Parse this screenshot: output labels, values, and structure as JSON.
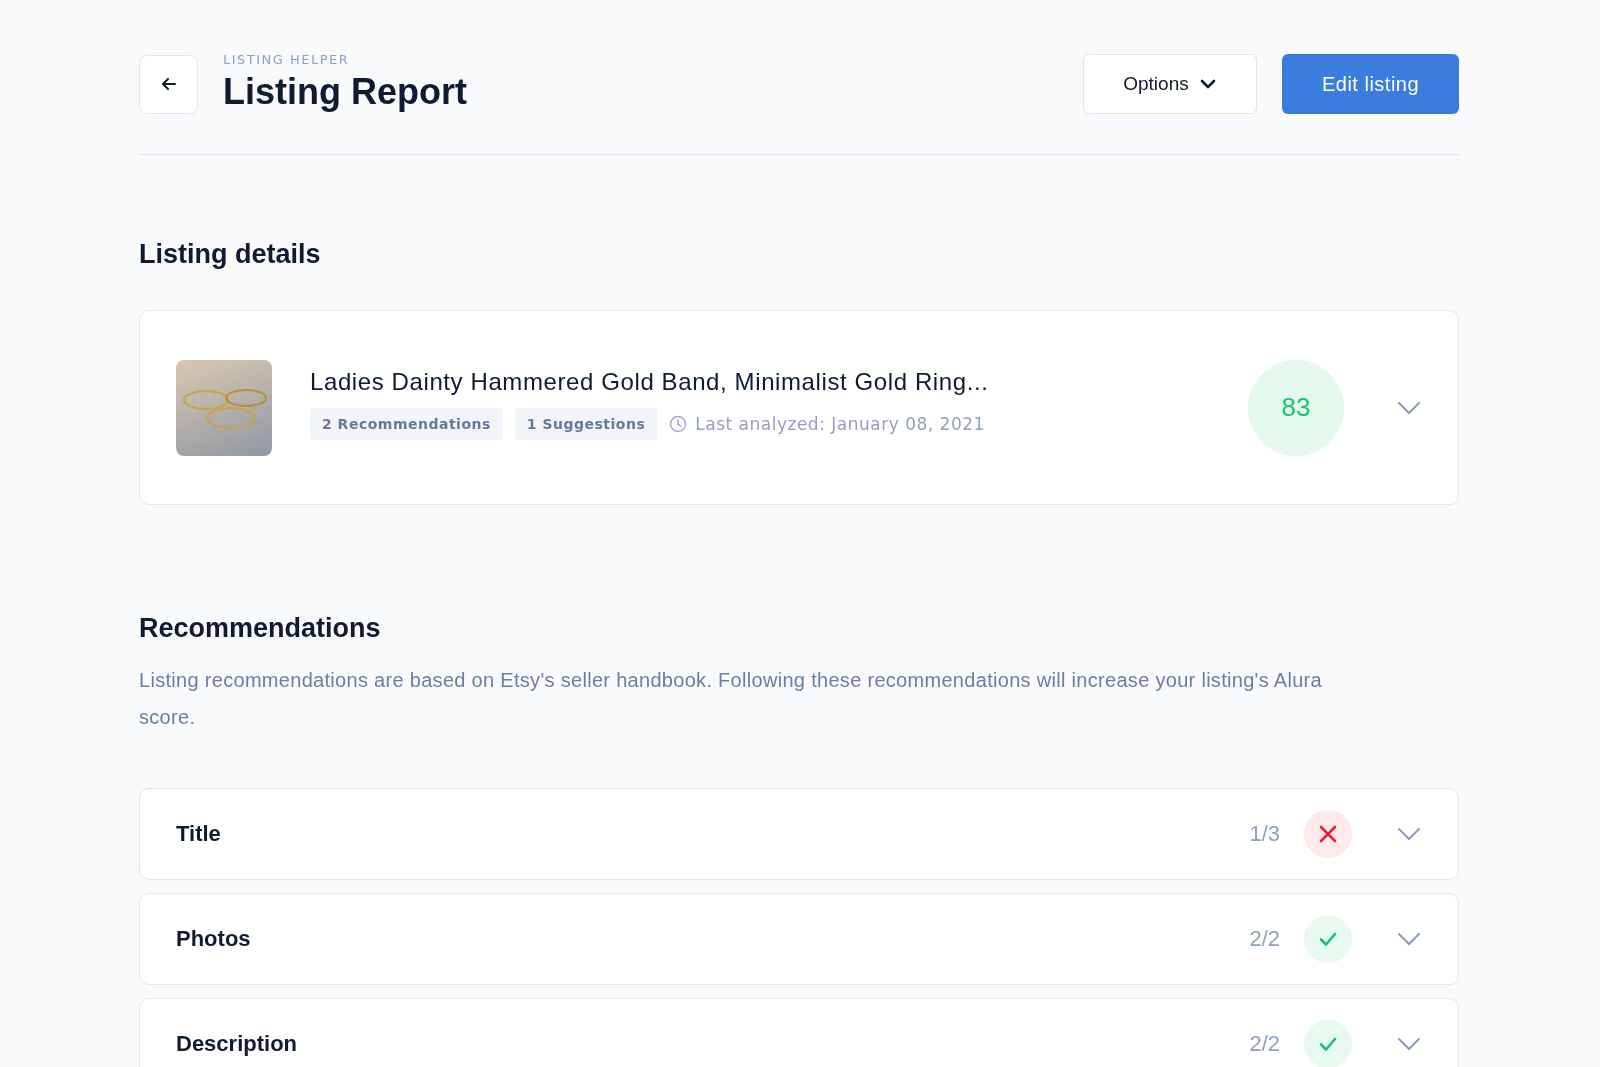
{
  "header": {
    "eyebrow": "LISTING HELPER",
    "title": "Listing Report",
    "options_button": "Options",
    "edit_button": "Edit listing"
  },
  "listing_details": {
    "heading": "Listing details",
    "title": "Ladies Dainty Hammered Gold Band, Minimalist Gold Ring...",
    "tags": [
      "2 Recommendations",
      "1 Suggestions"
    ],
    "last_analyzed": "Last analyzed: January 08, 2021",
    "score": "83"
  },
  "recommendations": {
    "heading": "Recommendations",
    "description": "Listing recommendations are based on Etsy's seller handbook. Following these recommendations will increase your listing's Alura score.",
    "items": [
      {
        "label": "Title",
        "score": "1/3",
        "passed": false
      },
      {
        "label": "Photos",
        "score": "2/2",
        "passed": true
      },
      {
        "label": "Description",
        "score": "2/2",
        "passed": true
      }
    ]
  }
}
